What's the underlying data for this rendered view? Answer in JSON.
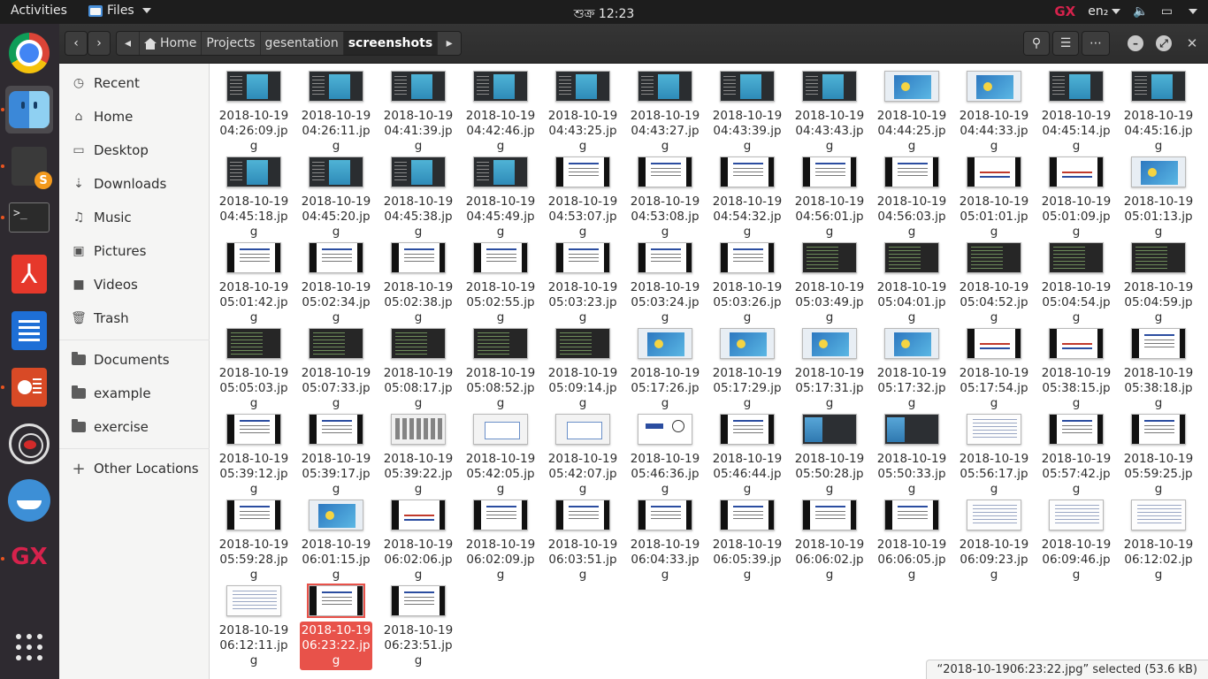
{
  "topbar": {
    "activities": "Activities",
    "app_name": "Files",
    "clock": "শুক্র 12:23",
    "tray_gx": "GX",
    "keyboard_layout": "en₂"
  },
  "toolbar": {
    "breadcrumbs": [
      "Home",
      "Projects",
      "gesentation",
      "screenshots"
    ],
    "current_folder": "screenshots"
  },
  "sidebar": {
    "places": [
      {
        "label": "Recent",
        "icon": "clock-icon"
      },
      {
        "label": "Home",
        "icon": "home-icon"
      },
      {
        "label": "Desktop",
        "icon": "desktop-icon"
      },
      {
        "label": "Downloads",
        "icon": "download-icon"
      },
      {
        "label": "Music",
        "icon": "music-icon"
      },
      {
        "label": "Pictures",
        "icon": "pictures-icon"
      },
      {
        "label": "Videos",
        "icon": "video-icon"
      },
      {
        "label": "Trash",
        "icon": "trash-icon"
      }
    ],
    "bookmarks": [
      {
        "label": "Documents",
        "icon": "folder-icon"
      },
      {
        "label": "example",
        "icon": "folder-icon"
      },
      {
        "label": "exercise",
        "icon": "folder-icon"
      }
    ],
    "other": {
      "label": "Other Locations",
      "icon": "plus-icon"
    }
  },
  "files": [
    {
      "name": "2018-10-1904:26:09.jpg",
      "thumb": "ide"
    },
    {
      "name": "2018-10-1904:26:11.jpg",
      "thumb": "ide"
    },
    {
      "name": "2018-10-1904:41:39.jpg",
      "thumb": "ide"
    },
    {
      "name": "2018-10-1904:42:46.jpg",
      "thumb": "ide"
    },
    {
      "name": "2018-10-1904:43:25.jpg",
      "thumb": "ide"
    },
    {
      "name": "2018-10-1904:43:27.jpg",
      "thumb": "ide"
    },
    {
      "name": "2018-10-1904:43:39.jpg",
      "thumb": "ide"
    },
    {
      "name": "2018-10-1904:43:43.jpg",
      "thumb": "ide"
    },
    {
      "name": "2018-10-1904:44:25.jpg",
      "thumb": "blue"
    },
    {
      "name": "2018-10-1904:44:33.jpg",
      "thumb": "blue"
    },
    {
      "name": "2018-10-1904:45:14.jpg",
      "thumb": "ide"
    },
    {
      "name": "2018-10-1904:45:16.jpg",
      "thumb": "ide"
    },
    {
      "name": "2018-10-1904:45:18.jpg",
      "thumb": "ide"
    },
    {
      "name": "2018-10-1904:45:20.jpg",
      "thumb": "ide"
    },
    {
      "name": "2018-10-1904:45:38.jpg",
      "thumb": "ide"
    },
    {
      "name": "2018-10-1904:45:49.jpg",
      "thumb": "ide"
    },
    {
      "name": "2018-10-1904:53:07.jpg",
      "thumb": "slide"
    },
    {
      "name": "2018-10-1904:53:08.jpg",
      "thumb": "slide"
    },
    {
      "name": "2018-10-1904:54:32.jpg",
      "thumb": "slide"
    },
    {
      "name": "2018-10-1904:56:01.jpg",
      "thumb": "slide"
    },
    {
      "name": "2018-10-1904:56:03.jpg",
      "thumb": "slide"
    },
    {
      "name": "2018-10-1905:01:01.jpg",
      "thumb": "title"
    },
    {
      "name": "2018-10-1905:01:09.jpg",
      "thumb": "title"
    },
    {
      "name": "2018-10-1905:01:13.jpg",
      "thumb": "blue"
    },
    {
      "name": "2018-10-1905:01:42.jpg",
      "thumb": "slide"
    },
    {
      "name": "2018-10-1905:02:34.jpg",
      "thumb": "slide"
    },
    {
      "name": "2018-10-1905:02:38.jpg",
      "thumb": "slide"
    },
    {
      "name": "2018-10-1905:02:55.jpg",
      "thumb": "slide"
    },
    {
      "name": "2018-10-1905:03:23.jpg",
      "thumb": "slide"
    },
    {
      "name": "2018-10-1905:03:24.jpg",
      "thumb": "slide"
    },
    {
      "name": "2018-10-1905:03:26.jpg",
      "thumb": "slide"
    },
    {
      "name": "2018-10-1905:03:49.jpg",
      "thumb": "dark"
    },
    {
      "name": "2018-10-1905:04:01.jpg",
      "thumb": "dark"
    },
    {
      "name": "2018-10-1905:04:52.jpg",
      "thumb": "dark"
    },
    {
      "name": "2018-10-1905:04:54.jpg",
      "thumb": "dark"
    },
    {
      "name": "2018-10-1905:04:59.jpg",
      "thumb": "dark"
    },
    {
      "name": "2018-10-1905:05:03.jpg",
      "thumb": "dark"
    },
    {
      "name": "2018-10-1905:07:33.jpg",
      "thumb": "dark"
    },
    {
      "name": "2018-10-1905:08:17.jpg",
      "thumb": "dark"
    },
    {
      "name": "2018-10-1905:08:52.jpg",
      "thumb": "dark"
    },
    {
      "name": "2018-10-1905:09:14.jpg",
      "thumb": "dark"
    },
    {
      "name": "2018-10-1905:17:26.jpg",
      "thumb": "blue"
    },
    {
      "name": "2018-10-1905:17:29.jpg",
      "thumb": "blue"
    },
    {
      "name": "2018-10-1905:17:31.jpg",
      "thumb": "blue"
    },
    {
      "name": "2018-10-1905:17:32.jpg",
      "thumb": "blue"
    },
    {
      "name": "2018-10-1905:17:54.jpg",
      "thumb": "title"
    },
    {
      "name": "2018-10-1905:38:15.jpg",
      "thumb": "title"
    },
    {
      "name": "2018-10-1905:38:18.jpg",
      "thumb": "slide"
    },
    {
      "name": "2018-10-1905:39:12.jpg",
      "thumb": "slide"
    },
    {
      "name": "2018-10-1905:39:17.jpg",
      "thumb": "slide"
    },
    {
      "name": "2018-10-1905:39:22.jpg",
      "thumb": "keys"
    },
    {
      "name": "2018-10-1905:42:05.jpg",
      "thumb": "dialog"
    },
    {
      "name": "2018-10-1905:42:07.jpg",
      "thumb": "dialog"
    },
    {
      "name": "2018-10-1905:46:36.jpg",
      "thumb": "logo"
    },
    {
      "name": "2018-10-1905:46:44.jpg",
      "thumb": "slide"
    },
    {
      "name": "2018-10-1905:50:28.jpg",
      "thumb": "split"
    },
    {
      "name": "2018-10-1905:50:33.jpg",
      "thumb": "split"
    },
    {
      "name": "2018-10-1905:56:17.jpg",
      "thumb": "doc"
    },
    {
      "name": "2018-10-1905:57:42.jpg",
      "thumb": "slide"
    },
    {
      "name": "2018-10-1905:59:25.jpg",
      "thumb": "slide"
    },
    {
      "name": "2018-10-1905:59:28.jpg",
      "thumb": "slide"
    },
    {
      "name": "2018-10-1906:01:15.jpg",
      "thumb": "blue"
    },
    {
      "name": "2018-10-1906:02:06.jpg",
      "thumb": "title"
    },
    {
      "name": "2018-10-1906:02:09.jpg",
      "thumb": "slide"
    },
    {
      "name": "2018-10-1906:03:51.jpg",
      "thumb": "slide"
    },
    {
      "name": "2018-10-1906:04:33.jpg",
      "thumb": "slide"
    },
    {
      "name": "2018-10-1906:05:39.jpg",
      "thumb": "slide"
    },
    {
      "name": "2018-10-1906:06:02.jpg",
      "thumb": "slide"
    },
    {
      "name": "2018-10-1906:06:05.jpg",
      "thumb": "slide"
    },
    {
      "name": "2018-10-1906:09:23.jpg",
      "thumb": "doc"
    },
    {
      "name": "2018-10-1906:09:46.jpg",
      "thumb": "doc"
    },
    {
      "name": "2018-10-1906:12:02.jpg",
      "thumb": "doc"
    },
    {
      "name": "2018-10-1906:12:11.jpg",
      "thumb": "doc"
    },
    {
      "name": "2018-10-1906:23:22.jpg",
      "thumb": "slide",
      "selected": true
    },
    {
      "name": "2018-10-1906:23:51.jpg",
      "thumb": "slide"
    }
  ],
  "status": {
    "text": "“2018-10-1906:23:22.jpg” selected  (53.6 kB)"
  },
  "colors": {
    "accent": "#e8524a",
    "dock_bg": "#2e2a30",
    "headerbar_bg": "#2d2d2d",
    "topbar_bg": "#1d1d1d"
  }
}
